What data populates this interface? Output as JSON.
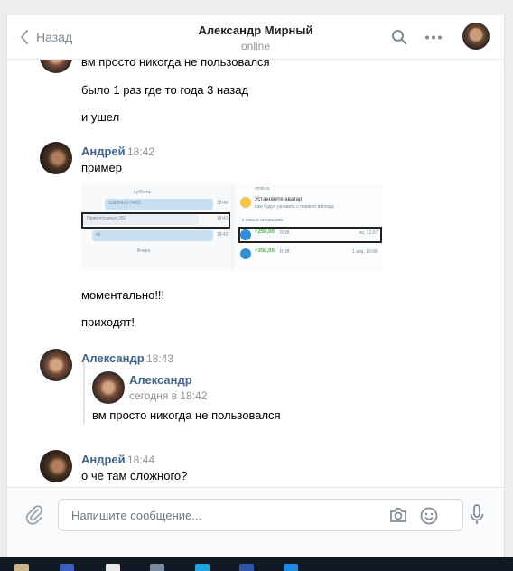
{
  "header": {
    "back_label": "Назад",
    "title": "Александр Мирный",
    "status": "online"
  },
  "messages": {
    "m0_text": "вм просто никогда не пользовался",
    "m1_text": "было 1 раз где то года 3 назад",
    "m2_text": "и ушел",
    "g1_author": "Андрей",
    "g1_time": "18:42",
    "g1_text": "пример",
    "g1_text2": "моментально!!!",
    "g1_text3": "приходят!",
    "g2_author": "Александр",
    "g2_time": "18:43",
    "quote_author": "Александр",
    "quote_time": "сегодня в 18:42",
    "quote_text": "вм просто никогда не пользовался",
    "g3_author": "Андрей",
    "g3_time": "18:44",
    "g3_text": "о че там сложного?"
  },
  "photo": {
    "day_label": "суббота",
    "row1": "5280042276403",
    "row1_time": "18:40",
    "row2": "Привет/скинул 250",
    "row2_time": "18:41",
    "row3": "ok",
    "row3_time": "18:42",
    "day2": "Вчера",
    "site": "vmlo.ru",
    "avatar_title": "Установите аватар",
    "avatar_sub": "вам будут узнавать с первого взгляда",
    "ops_label": "к новым операциям",
    "op1_amount": "+250,00",
    "op1_cur": "RUB",
    "op1_time": "вс, 12:07",
    "op2_amount": "+350,00",
    "op2_cur": "RUB",
    "op2_time": "1 апр, 10:08"
  },
  "composer": {
    "placeholder": "Напишите сообщение..."
  },
  "colors": {
    "accent": "#42648b",
    "muted": "#939393"
  }
}
